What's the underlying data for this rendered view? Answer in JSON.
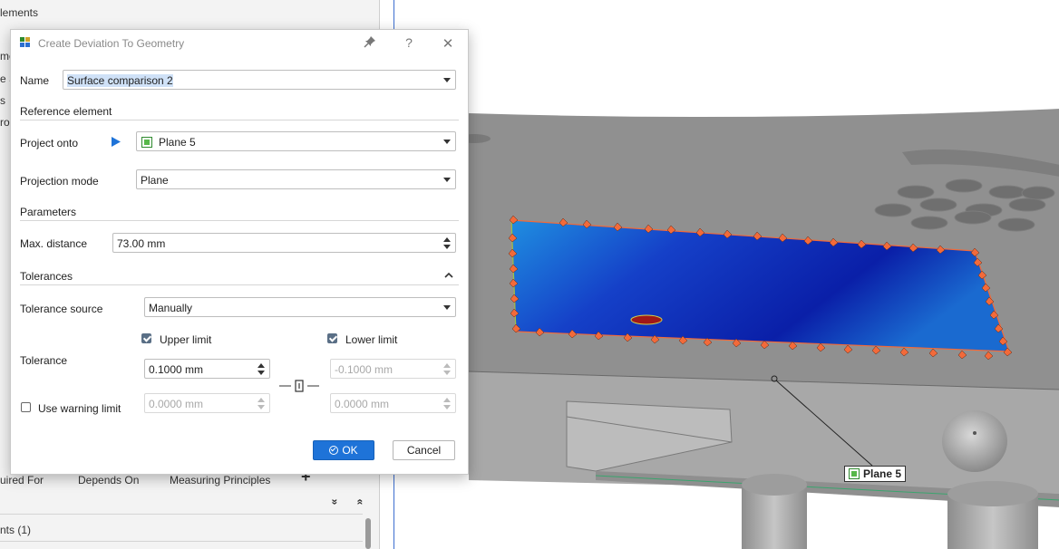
{
  "left_panel": {
    "fragments": [
      "lements",
      "me",
      "e S",
      "s",
      "ro"
    ],
    "tabs": [
      "uired For",
      "Depends On",
      "Measuring Principles"
    ],
    "add_symbol": "+",
    "list_header": "nts (1)",
    "collapse_down": "»",
    "collapse_up": "«"
  },
  "dialog": {
    "title": "Create Deviation To Geometry",
    "pin_icon": "pin-icon",
    "help_label": "?",
    "close_label": "✕",
    "name_label": "Name",
    "name_value": "Surface comparison 2",
    "reference_section": "Reference element",
    "project_onto_label": "Project onto",
    "project_onto_value": "Plane 5",
    "projection_mode_label": "Projection mode",
    "projection_mode_value": "Plane",
    "parameters_section": "Parameters",
    "max_distance_label": "Max. distance",
    "max_distance_value": "73.00 mm",
    "tolerances_section": "Tolerances",
    "tolerance_source_label": "Tolerance source",
    "tolerance_source_value": "Manually",
    "upper_limit_label": "Upper limit",
    "upper_limit_checked": true,
    "lower_limit_label": "Lower limit",
    "lower_limit_checked": true,
    "tolerance_label": "Tolerance",
    "upper_value": "0.1000 mm",
    "lower_value": "-0.1000 mm",
    "use_warning_label": "Use warning limit",
    "use_warning_checked": false,
    "warning_upper_value": "0.0000 mm",
    "warning_lower_value": "0.0000 mm",
    "link_symbol": "—⟦⟧—",
    "ok_label": "OK",
    "cancel_label": "Cancel"
  },
  "viewport": {
    "plane_label": "Plane 5"
  },
  "colors": {
    "accent": "#1e73d8",
    "deviation_low": "#0a1fa8",
    "deviation_high": "#1ba3d6",
    "edge_marker": "#f26a3a"
  }
}
